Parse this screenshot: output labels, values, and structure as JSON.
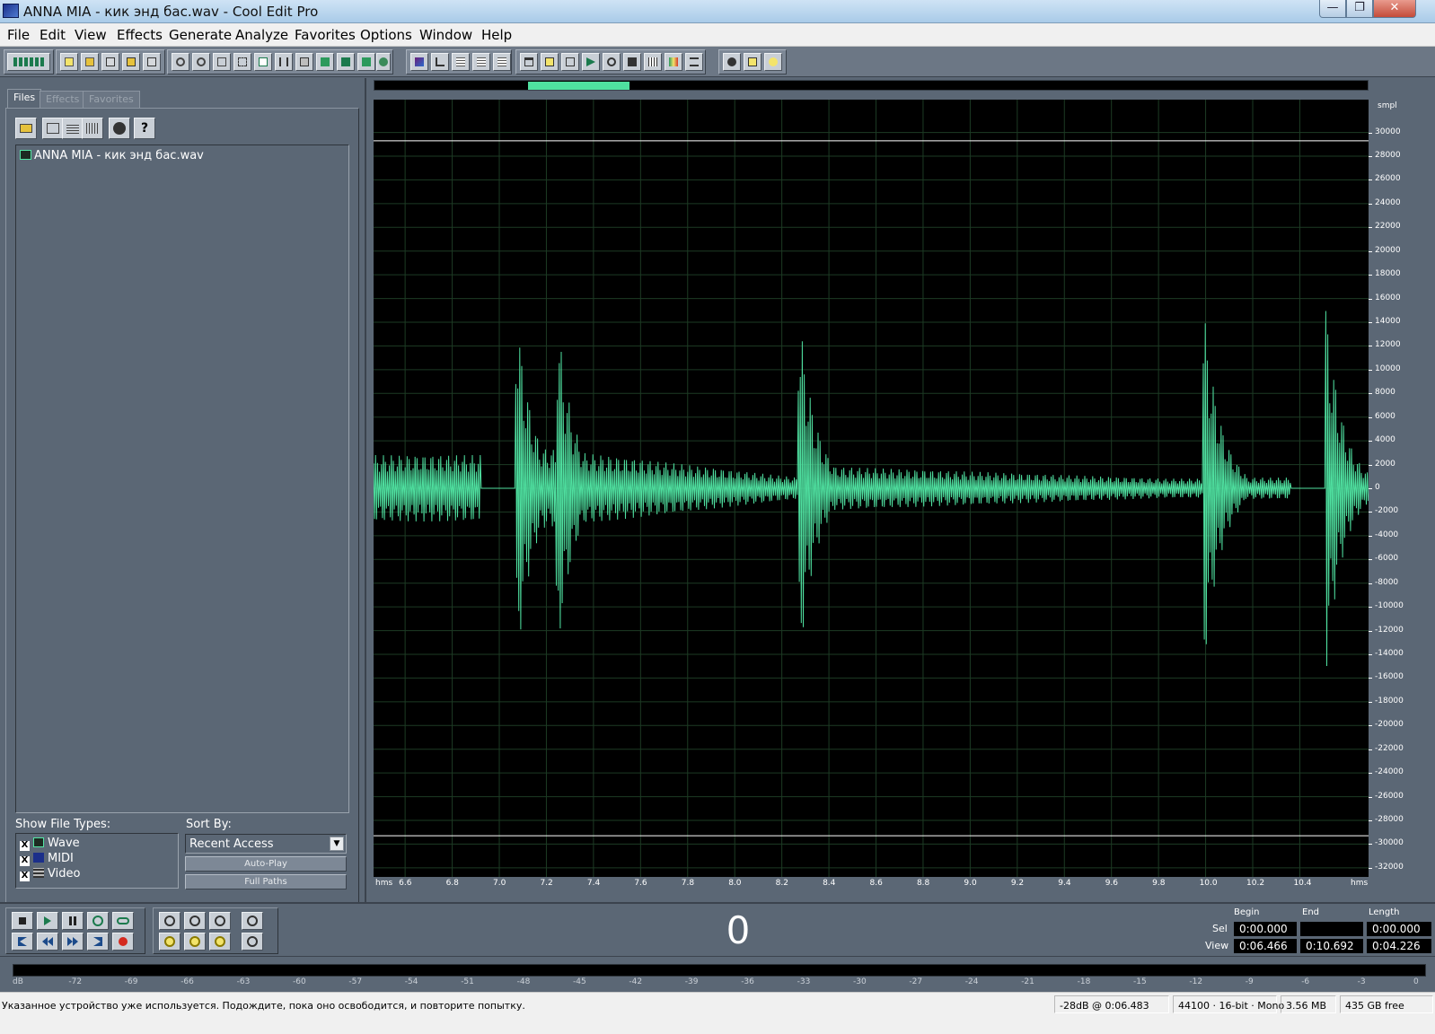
{
  "window": {
    "title": "ANNA MIA - кик энд бас.wav - Cool Edit Pro",
    "minimize": "—",
    "maximize": "❐",
    "close": "✕"
  },
  "menu": {
    "items": [
      "File",
      "Edit",
      "View",
      "Effects",
      "Generate",
      "Analyze",
      "Favorites",
      "Options",
      "Window",
      "Help"
    ]
  },
  "left_panel": {
    "tabs": [
      "Files",
      "Effects",
      "Favorites"
    ],
    "active_tab": "Files",
    "files": [
      "ANNA MIA - кик энд бас.wav"
    ],
    "show_file_types_label": "Show File Types:",
    "file_types": [
      {
        "label": "Wave",
        "checked": "X"
      },
      {
        "label": "MIDI",
        "checked": "X"
      },
      {
        "label": "Video",
        "checked": "X"
      }
    ],
    "sort_by_label": "Sort By:",
    "sort_by_value": "Recent Access",
    "auto_play": "Auto-Play",
    "full_paths": "Full Paths",
    "help_button": "?"
  },
  "waveform": {
    "y_unit": "smpl",
    "y_ticks": [
      "30000",
      "28000",
      "26000",
      "24000",
      "22000",
      "20000",
      "18000",
      "16000",
      "14000",
      "12000",
      "10000",
      "8000",
      "6000",
      "4000",
      "2000",
      "0",
      "-2000",
      "-4000",
      "-6000",
      "-8000",
      "-10000",
      "-12000",
      "-14000",
      "-16000",
      "-18000",
      "-20000",
      "-22000",
      "-24000",
      "-26000",
      "-28000",
      "-30000",
      "-32000"
    ],
    "x_unit": "hms",
    "x_ticks": [
      "6.6",
      "6.8",
      "7.0",
      "7.2",
      "7.4",
      "7.6",
      "7.8",
      "8.0",
      "8.2",
      "8.4",
      "8.6",
      "8.8",
      "9.0",
      "9.2",
      "9.4",
      "9.6",
      "9.8",
      "10.0",
      "10.2",
      "10.4"
    ],
    "x_range": [
      6.466,
      10.692
    ],
    "y_range": [
      -32768,
      32767
    ],
    "clip_lines": [
      29300,
      -29300
    ],
    "wave_color": "#4fe0a0",
    "grid_color": "#1d3b24",
    "overview_selection": [
      0.155,
      0.257
    ]
  },
  "transport": {
    "time": "0",
    "headers": {
      "begin": "Begin",
      "end": "End",
      "length": "Length"
    },
    "sel_label": "Sel",
    "view_label": "View",
    "sel": {
      "begin": "0:00.000",
      "end": "",
      "length": "0:00.000"
    },
    "view": {
      "begin": "0:06.466",
      "end": "0:10.692",
      "length": "0:04.226"
    }
  },
  "meter": {
    "ticks": [
      "dB",
      "-72",
      "-69",
      "-66",
      "-63",
      "-60",
      "-57",
      "-54",
      "-51",
      "-48",
      "-45",
      "-42",
      "-39",
      "-36",
      "-33",
      "-30",
      "-27",
      "-24",
      "-21",
      "-18",
      "-15",
      "-12",
      "-9",
      "-6",
      "-3",
      "0"
    ]
  },
  "status": {
    "message": "Указанное устройство уже используется. Подождите, пока оно освободится, и повторите попытку.",
    "level": "-28dB @  0:06.483",
    "format": "44100 · 16-bit · Mono",
    "size": "3.56 MB",
    "free": "435 GB free"
  }
}
